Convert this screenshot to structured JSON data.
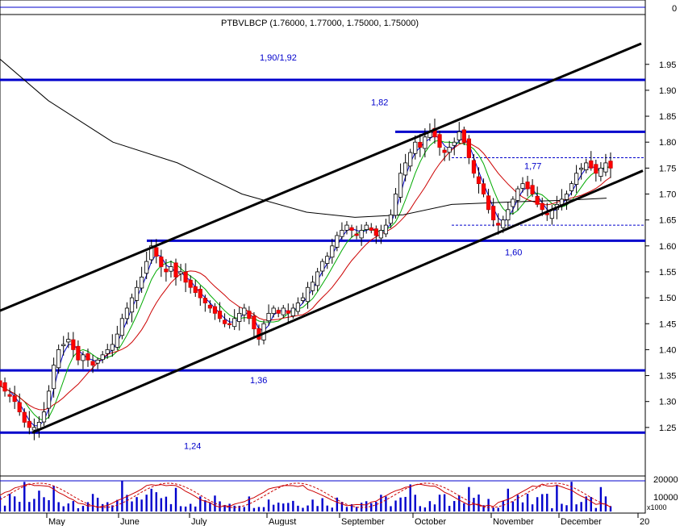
{
  "chart_data": {
    "type": "candlestick",
    "title": "PTBVLBCP (1.76000, 1.77000, 1.75000, 1.75000)",
    "top_strip_label": "0",
    "ylim": [
      1.2,
      2.0
    ],
    "y_ticks": [
      "1.25",
      "1.30",
      "1.35",
      "1.40",
      "1.45",
      "1.50",
      "1.55",
      "1.60",
      "1.65",
      "1.70",
      "1.75",
      "1.80",
      "1.85",
      "1.90",
      "1.95"
    ],
    "months": [
      "May",
      "June",
      "July",
      "August",
      "September",
      "October",
      "November",
      "December",
      "20"
    ],
    "horizontal_levels": [
      {
        "value": 1.92,
        "label": "1,90/1,92"
      },
      {
        "value": 1.82,
        "label": "1,82"
      },
      {
        "value": 1.77,
        "label": "1,77"
      },
      {
        "value": 1.61,
        "label": "1,60"
      },
      {
        "value": 1.36,
        "label": "1,36"
      },
      {
        "value": 1.24,
        "label": "1,24"
      }
    ],
    "dashed_levels": [
      1.77,
      1.64
    ],
    "channel_lines": [
      {
        "from": [
          0,
          1.475
        ],
        "to": [
          795,
          1.99
        ]
      },
      {
        "from": [
          40,
          1.24
        ],
        "to": [
          797,
          1.745
        ]
      }
    ],
    "closes": [
      1.33,
      1.32,
      1.31,
      1.3,
      1.28,
      1.26,
      1.25,
      1.25,
      1.26,
      1.28,
      1.32,
      1.37,
      1.4,
      1.41,
      1.42,
      1.4,
      1.38,
      1.39,
      1.38,
      1.37,
      1.38,
      1.39,
      1.4,
      1.41,
      1.43,
      1.46,
      1.48,
      1.5,
      1.52,
      1.54,
      1.57,
      1.6,
      1.58,
      1.56,
      1.55,
      1.56,
      1.54,
      1.55,
      1.53,
      1.52,
      1.51,
      1.5,
      1.49,
      1.48,
      1.47,
      1.46,
      1.45,
      1.45,
      1.46,
      1.47,
      1.48,
      1.46,
      1.44,
      1.42,
      1.45,
      1.47,
      1.48,
      1.47,
      1.48,
      1.47,
      1.48,
      1.49,
      1.5,
      1.52,
      1.53,
      1.55,
      1.57,
      1.58,
      1.6,
      1.62,
      1.63,
      1.64,
      1.63,
      1.62,
      1.63,
      1.64,
      1.63,
      1.62,
      1.63,
      1.64,
      1.66,
      1.7,
      1.74,
      1.76,
      1.78,
      1.8,
      1.79,
      1.81,
      1.82,
      1.81,
      1.79,
      1.78,
      1.79,
      1.8,
      1.82,
      1.8,
      1.77,
      1.74,
      1.72,
      1.7,
      1.67,
      1.65,
      1.64,
      1.65,
      1.67,
      1.69,
      1.71,
      1.72,
      1.71,
      1.7,
      1.68,
      1.67,
      1.66,
      1.67,
      1.68,
      1.69,
      1.7,
      1.72,
      1.74,
      1.75,
      1.76,
      1.75,
      1.74,
      1.75,
      1.76,
      1.75
    ],
    "oscillator_label": "20000",
    "oscillator_sublabel": "10000",
    "volume_scale_label": "x1000"
  }
}
